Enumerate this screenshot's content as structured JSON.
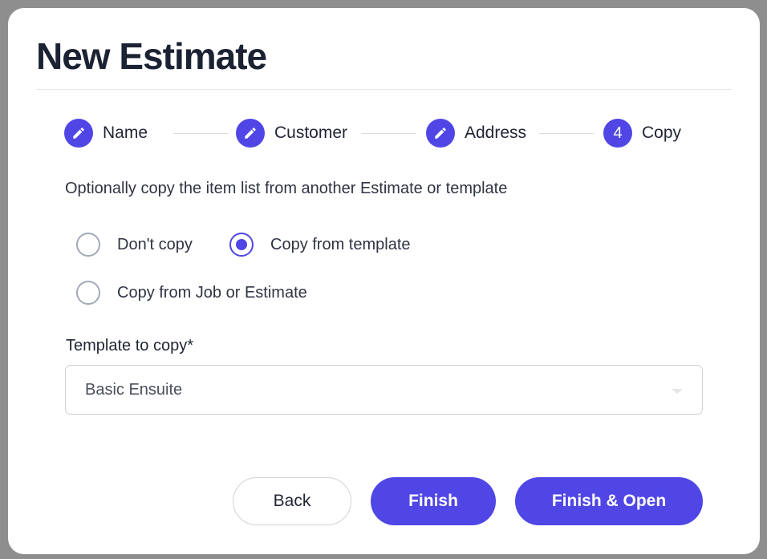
{
  "dialog": {
    "title": "New Estimate"
  },
  "stepper": {
    "steps": [
      {
        "label": "Name",
        "icon": "pencil-icon",
        "badge": ""
      },
      {
        "label": "Customer",
        "icon": "pencil-icon",
        "badge": ""
      },
      {
        "label": "Address",
        "icon": "pencil-icon",
        "badge": ""
      },
      {
        "label": "Copy",
        "icon": "",
        "badge": "4"
      }
    ],
    "active_step": 4
  },
  "copy_options": {
    "intro": "Optionally copy the item list from another Estimate or template",
    "options": [
      {
        "label": "Don't copy",
        "selected": false
      },
      {
        "label": "Copy from template",
        "selected": true
      },
      {
        "label": "Copy from Job or Estimate",
        "selected": false
      }
    ]
  },
  "template_field": {
    "label": "Template to copy*",
    "value": "Basic Ensuite"
  },
  "actions": {
    "back": "Back",
    "finish": "Finish",
    "finish_open": "Finish & Open"
  },
  "colors": {
    "accent": "#4f46e5",
    "title": "#1b2233"
  }
}
